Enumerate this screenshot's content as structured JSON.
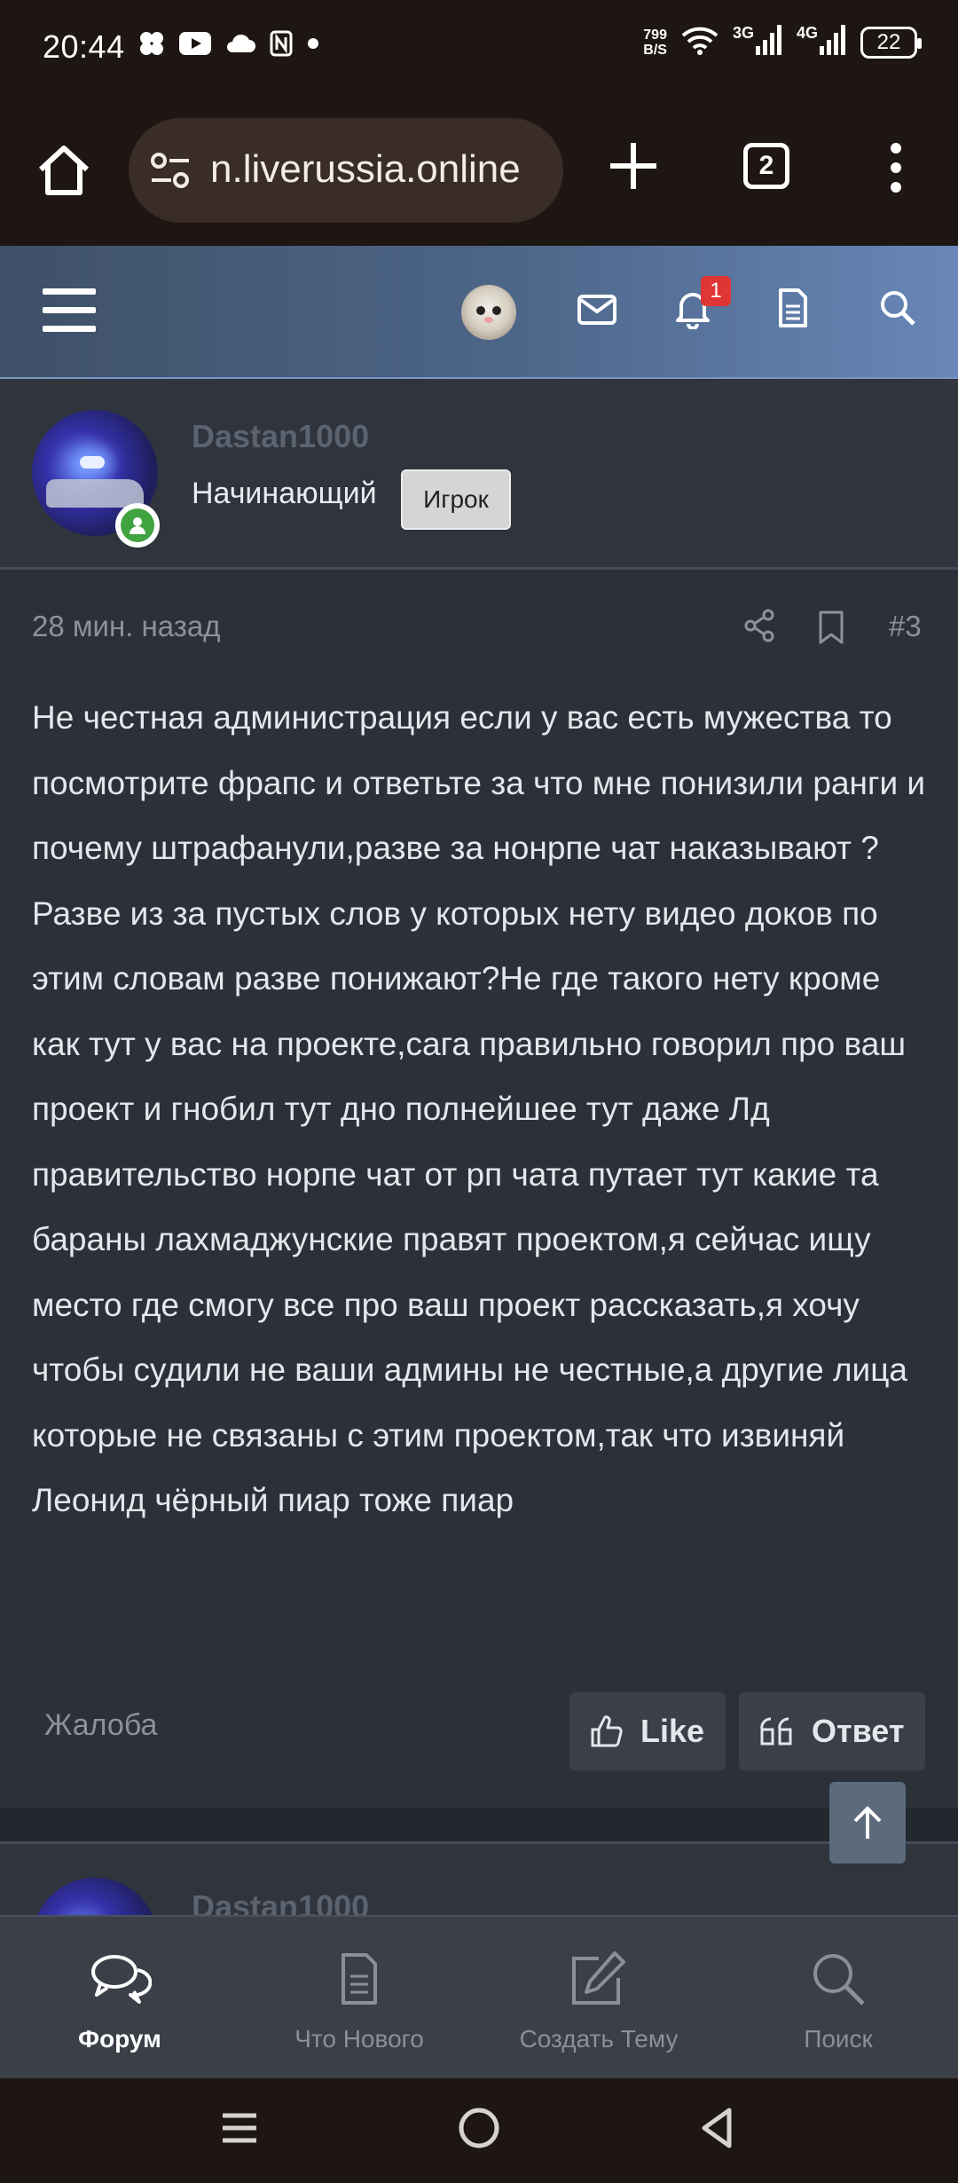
{
  "status_bar": {
    "time": "20:44",
    "net_speed_value": "799",
    "net_speed_unit": "B/S",
    "net_3g": "3G",
    "net_4g": "4G",
    "battery": "22"
  },
  "browser": {
    "url": "n.liverussia.online",
    "tab_count": "2"
  },
  "site_header": {
    "notification_count": "1"
  },
  "post": {
    "author_name": "Dastan1000",
    "author_rank": "Начинающий",
    "author_badge": "Игрок",
    "time_ago": "28 мин. назад",
    "post_number": "#3",
    "body": "Не честная администрация если у вас есть мужества то посмотрите фрапс и ответьте за что мне понизили ранги и почему штрафанули,разве за нонрпе чат наказывают ? Разве из за пустых слов у которых нету видео доков по этим словам разве понижают?Не где такого нету кроме как тут у вас на проекте,сага правильно говорил про ваш проект и гнобил тут дно полнейшее тут даже Лд правительство норпе чат от рп чата путает тут какие та бараны лахмаджунские правят проектом,я сейчас ищу место где смогу все про ваш проект рассказать,я хочу чтобы судили не ваши админы не честные,а другие лица которые не связаны с этим проектом,так что извиняй Леонид чёрный пиар тоже пиар",
    "report_label": "Жалоба",
    "like_label": "Like",
    "reply_label": "Ответ"
  },
  "next_post": {
    "author_name": "Dastan1000"
  },
  "bottom_nav": {
    "items": [
      {
        "label": "Форум",
        "icon": "chat-bubbles-icon",
        "active": true
      },
      {
        "label": "Что Нового",
        "icon": "document-icon",
        "active": false
      },
      {
        "label": "Создать Тему",
        "icon": "edit-icon",
        "active": false
      },
      {
        "label": "Поиск",
        "icon": "search-icon",
        "active": false
      }
    ]
  },
  "colors": {
    "system_bar_bg": "#1e1612",
    "header_gradient_start": "#3f5068",
    "header_gradient_end": "#6887b8",
    "page_bg": "#2b3039",
    "notification_badge": "#e03535",
    "online_indicator": "#3fa33f"
  }
}
